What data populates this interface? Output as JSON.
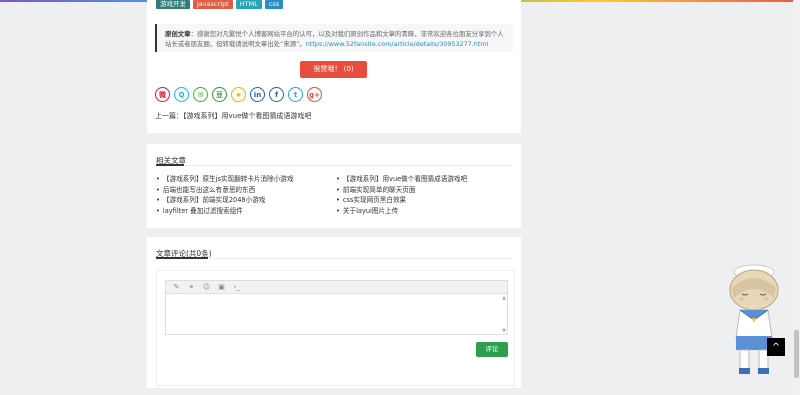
{
  "tags": [
    {
      "label": "游戏开发",
      "color": "#2f7d79"
    },
    {
      "label": "javascript",
      "color": "#e05d44"
    },
    {
      "label": "HTML",
      "color": "#2aa3b5"
    },
    {
      "label": "css",
      "color": "#2a8ec4"
    }
  ],
  "notice": {
    "label": "原创文章",
    "text": "：感谢您对凡繁悦个人博客网站平台的认可，以及对我们原创作品和文章的青睐，非常欢迎各位朋友分享到个人站长或者朋友圈，但转载请说明文章出处“来源”。",
    "url": "https://www.52fansite.com/article/details/30953277.html"
  },
  "like_button": "很赞哦！ (0)",
  "share_icons": [
    "weibo-icon",
    "qq-icon",
    "wechat-icon",
    "douban-icon",
    "qzone-icon",
    "linkedin-icon",
    "facebook-icon",
    "twitter-icon",
    "google-plus-icon"
  ],
  "share_glyphs": [
    "微",
    "Q",
    "✉",
    "豆",
    "★",
    "in",
    "f",
    "t",
    "g+"
  ],
  "share_colors": [
    "#e6162d",
    "#12b7f5",
    "#3cb034",
    "#2e963d",
    "#f7a900",
    "#0a66c2",
    "#3b5998",
    "#1da1f2",
    "#dd4b39"
  ],
  "prev_article": "上一篇：【游戏系列】用vue做个看图猜成语游戏吧",
  "related": {
    "title": "相关文章",
    "left": [
      "【游戏系列】原生js实现翻转卡片消除小游戏",
      "后端也能写出这么有意思的东西",
      "【游戏系列】前端实现2048小游戏",
      "layfilter 叠加过滤搜索组件"
    ],
    "right": [
      "【游戏系列】用vue做个看图猜成语游戏吧",
      "前端实现简单的聊天页面",
      "css实现网页黑白效果",
      "关于layui图片上传"
    ]
  },
  "comments": {
    "title": "文章评论(共0条)",
    "submit_label": "评论",
    "toolbar": [
      "pencil-icon",
      "link-icon",
      "emoji-icon",
      "image-icon",
      "code-icon"
    ],
    "toolbar_glyphs": [
      "✎",
      "⚭",
      "☺",
      "▣",
      "›_"
    ]
  },
  "back_to_top": "^"
}
